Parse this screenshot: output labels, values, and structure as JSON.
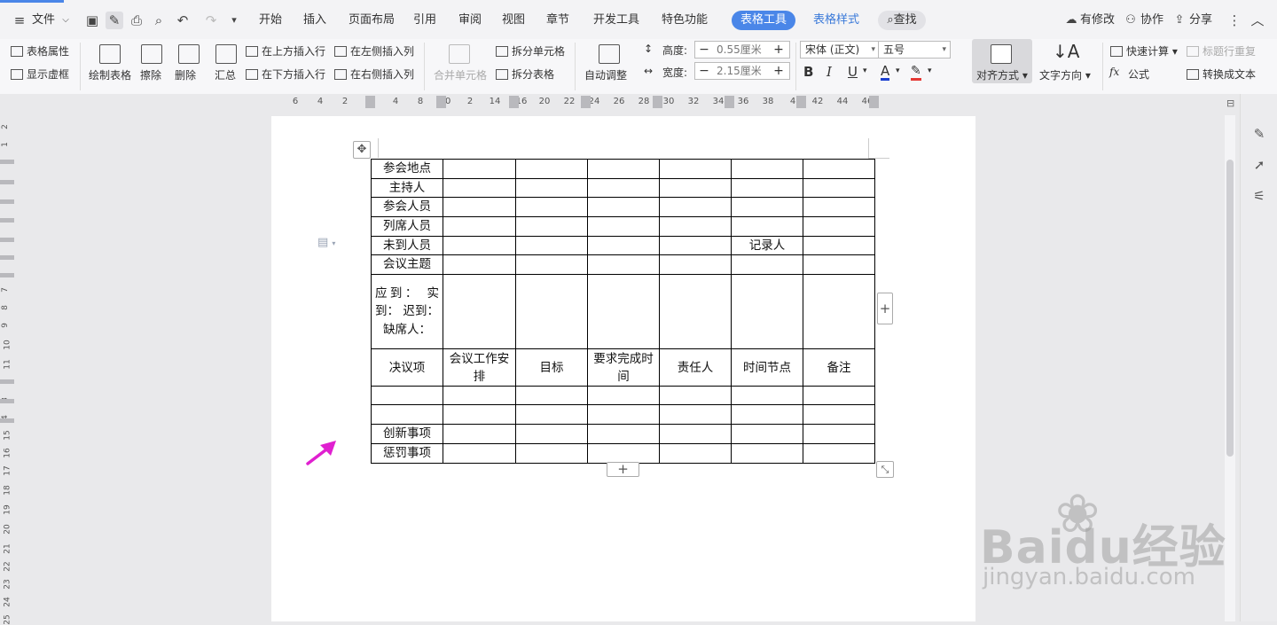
{
  "title_bar": {
    "menu_file": "文件",
    "tabs": [
      "开始",
      "插入",
      "页面布局",
      "引用",
      "审阅",
      "视图",
      "章节",
      "开发工具",
      "特色功能"
    ],
    "active_tab": "表格工具",
    "style_tab": "表格样式",
    "search": "查找",
    "status": "有修改",
    "collaborate": "协作",
    "share": "分享"
  },
  "ribbon": {
    "table_props": "表格属性",
    "show_gridlines": "显示虚框",
    "draw_table": "绘制表格",
    "erase": "擦除",
    "delete": "删除",
    "summary": "汇总",
    "insert_above": "在上方插入行",
    "insert_below": "在下方插入行",
    "insert_left": "在左侧插入列",
    "insert_right": "在右侧插入列",
    "merge_cells": "合并单元格",
    "split_cells": "拆分单元格",
    "split_table": "拆分表格",
    "auto_fit": "自动调整",
    "height_label": "高度:",
    "height_value": "0.55厘米",
    "width_label": "宽度:",
    "width_value": "2.15厘米",
    "font_name": "宋体 (正文)",
    "font_size": "五号",
    "align": "对齐方式",
    "text_direction": "文字方向",
    "quick_calc": "快速计算",
    "repeat_header": "标题行重复",
    "formula": "公式",
    "to_text": "转换成文本"
  },
  "ruler_numbers": [
    "6",
    "4",
    "2",
    "2",
    "4",
    "8",
    "10",
    "2",
    "14",
    "16",
    "20",
    "22",
    "24",
    "26",
    "28",
    "30",
    "32",
    "34",
    "36",
    "38",
    "4",
    "42",
    "44",
    "46"
  ],
  "vruler_numbers": [
    "2",
    "1",
    "7",
    "8",
    "9",
    "10",
    "11",
    "3",
    "4",
    "15",
    "16",
    "17",
    "18",
    "19",
    "20",
    "21",
    "22",
    "23",
    "24",
    "25"
  ],
  "table": {
    "rows": [
      [
        "参会地点",
        "",
        "",
        "",
        "",
        "",
        ""
      ],
      [
        "主持人",
        "",
        "",
        "",
        "",
        "",
        ""
      ],
      [
        "参会人员",
        "",
        "",
        "",
        "",
        "",
        ""
      ],
      [
        "列席人员",
        "",
        "",
        "",
        "",
        "",
        ""
      ],
      [
        "未到人员",
        "",
        "",
        "",
        "",
        "记录人",
        ""
      ],
      [
        "会议主题",
        "",
        "",
        "",
        "",
        "",
        ""
      ],
      [
        "应到：  实到：  迟到：  缺席人：",
        "",
        "",
        "",
        "",
        "",
        ""
      ],
      [
        "决议项",
        "会议工作安排",
        "目标",
        "要求完成时间",
        "责任人",
        "时间节点",
        "备注"
      ],
      [
        "",
        "",
        "",
        "",
        "",
        "",
        ""
      ],
      [
        "",
        "",
        "",
        "",
        "",
        "",
        ""
      ],
      [
        "创新事项",
        "",
        "",
        "",
        "",
        "",
        ""
      ],
      [
        "惩罚事项",
        "",
        "",
        "",
        "",
        "",
        ""
      ]
    ]
  },
  "watermark": {
    "logo": "Baidu经验",
    "url": "jingyan.baidu.com"
  },
  "colors": {
    "accent": "#4a86e8",
    "arrow": "#e020d0"
  }
}
